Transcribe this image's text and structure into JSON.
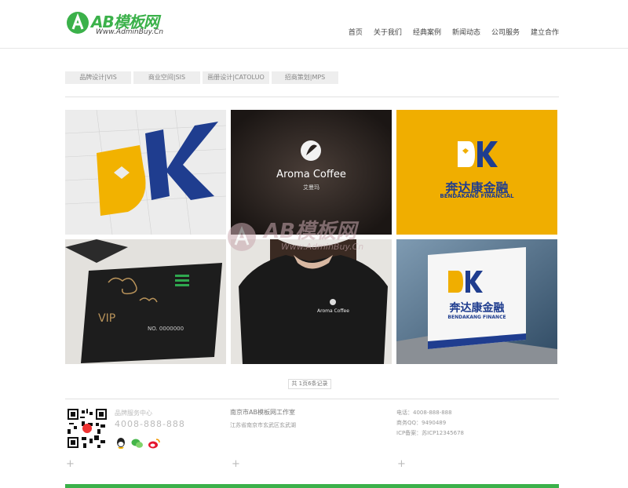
{
  "brand": {
    "logo_text": "AB模板网",
    "logo_sub": "Www.AdminBuy.Cn",
    "accent_color": "#3bb14a"
  },
  "nav": {
    "items": [
      {
        "label": "首页"
      },
      {
        "label": "关于我们"
      },
      {
        "label": "经典案例"
      },
      {
        "label": "新闻动态"
      },
      {
        "label": "公司服务"
      },
      {
        "label": "建立合作"
      }
    ]
  },
  "tabs": [
    {
      "label": "品牌设计|VIS"
    },
    {
      "label": "商业空间|SIS"
    },
    {
      "label": "画册设计|CATOLUO"
    },
    {
      "label": "招商策划|MPS"
    }
  ],
  "gallery": {
    "aroma_title": "Aroma Coffee",
    "aroma_sub": "艾曼玛",
    "bendakang_cn": "奔达康金融",
    "bendakang_en": "BENDAKANG FINANCIAL",
    "bendakang_en_sign": "BENDAKANG FINANCE",
    "vip_label": "VIP",
    "vip_card_no": "NO. 0000000",
    "shirt_text": "Aroma Coffee"
  },
  "pager": {
    "label": "共 1页6条记录"
  },
  "footer": {
    "col1_title": "品牌服务中心",
    "col1_phone": "4008-888-888",
    "col2_title": "南京市AB模板网工作室",
    "col2_addr": "江苏省南京市玄武区玄武湖",
    "col3_lines": [
      "电话：4008-888-888",
      "商务QQ：9490489",
      "ICP备案：苏ICP12345678"
    ]
  },
  "icons": [
    "qq-icon",
    "wechat-icon",
    "weibo-icon"
  ],
  "watermark": {
    "text": "AB模板网",
    "sub": "Www.AdminBuy.Cn"
  }
}
